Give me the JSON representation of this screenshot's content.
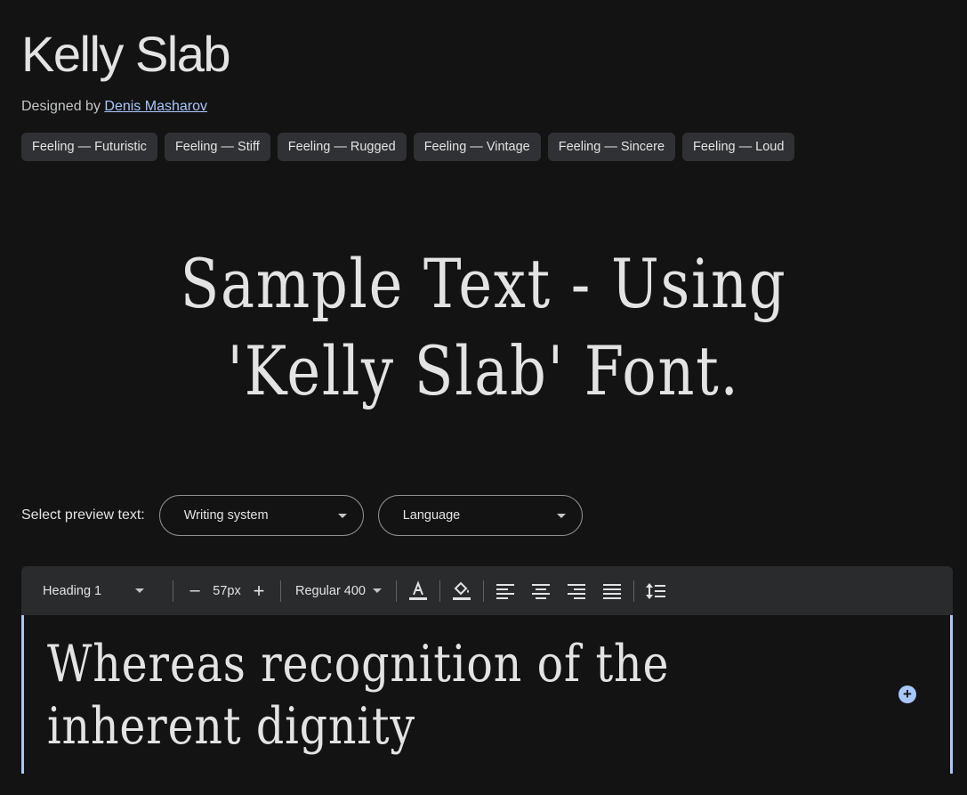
{
  "font": {
    "name": "Kelly Slab",
    "designed_by_prefix": "Designed by ",
    "designer": "Denis Masharov"
  },
  "tags": [
    "Feeling — Futuristic",
    "Feeling — Stiff",
    "Feeling — Rugged",
    "Feeling — Vintage",
    "Feeling — Sincere",
    "Feeling — Loud"
  ],
  "sample_text": "Sample Text - Using 'Kelly Slab' Font.",
  "preview": {
    "label": "Select preview text:",
    "writing_system": "Writing system",
    "language": "Language"
  },
  "toolbar": {
    "style": "Heading 1",
    "minus": "–",
    "size": "57px",
    "plus": "+",
    "weight": "Regular 400"
  },
  "editor": {
    "text": "Whereas recognition of the inherent dignity",
    "add": "+"
  },
  "colors": {
    "background": "#131314",
    "link": "#a8c7fa",
    "chip": "#303134",
    "toolbar": "#2a2b2d"
  }
}
